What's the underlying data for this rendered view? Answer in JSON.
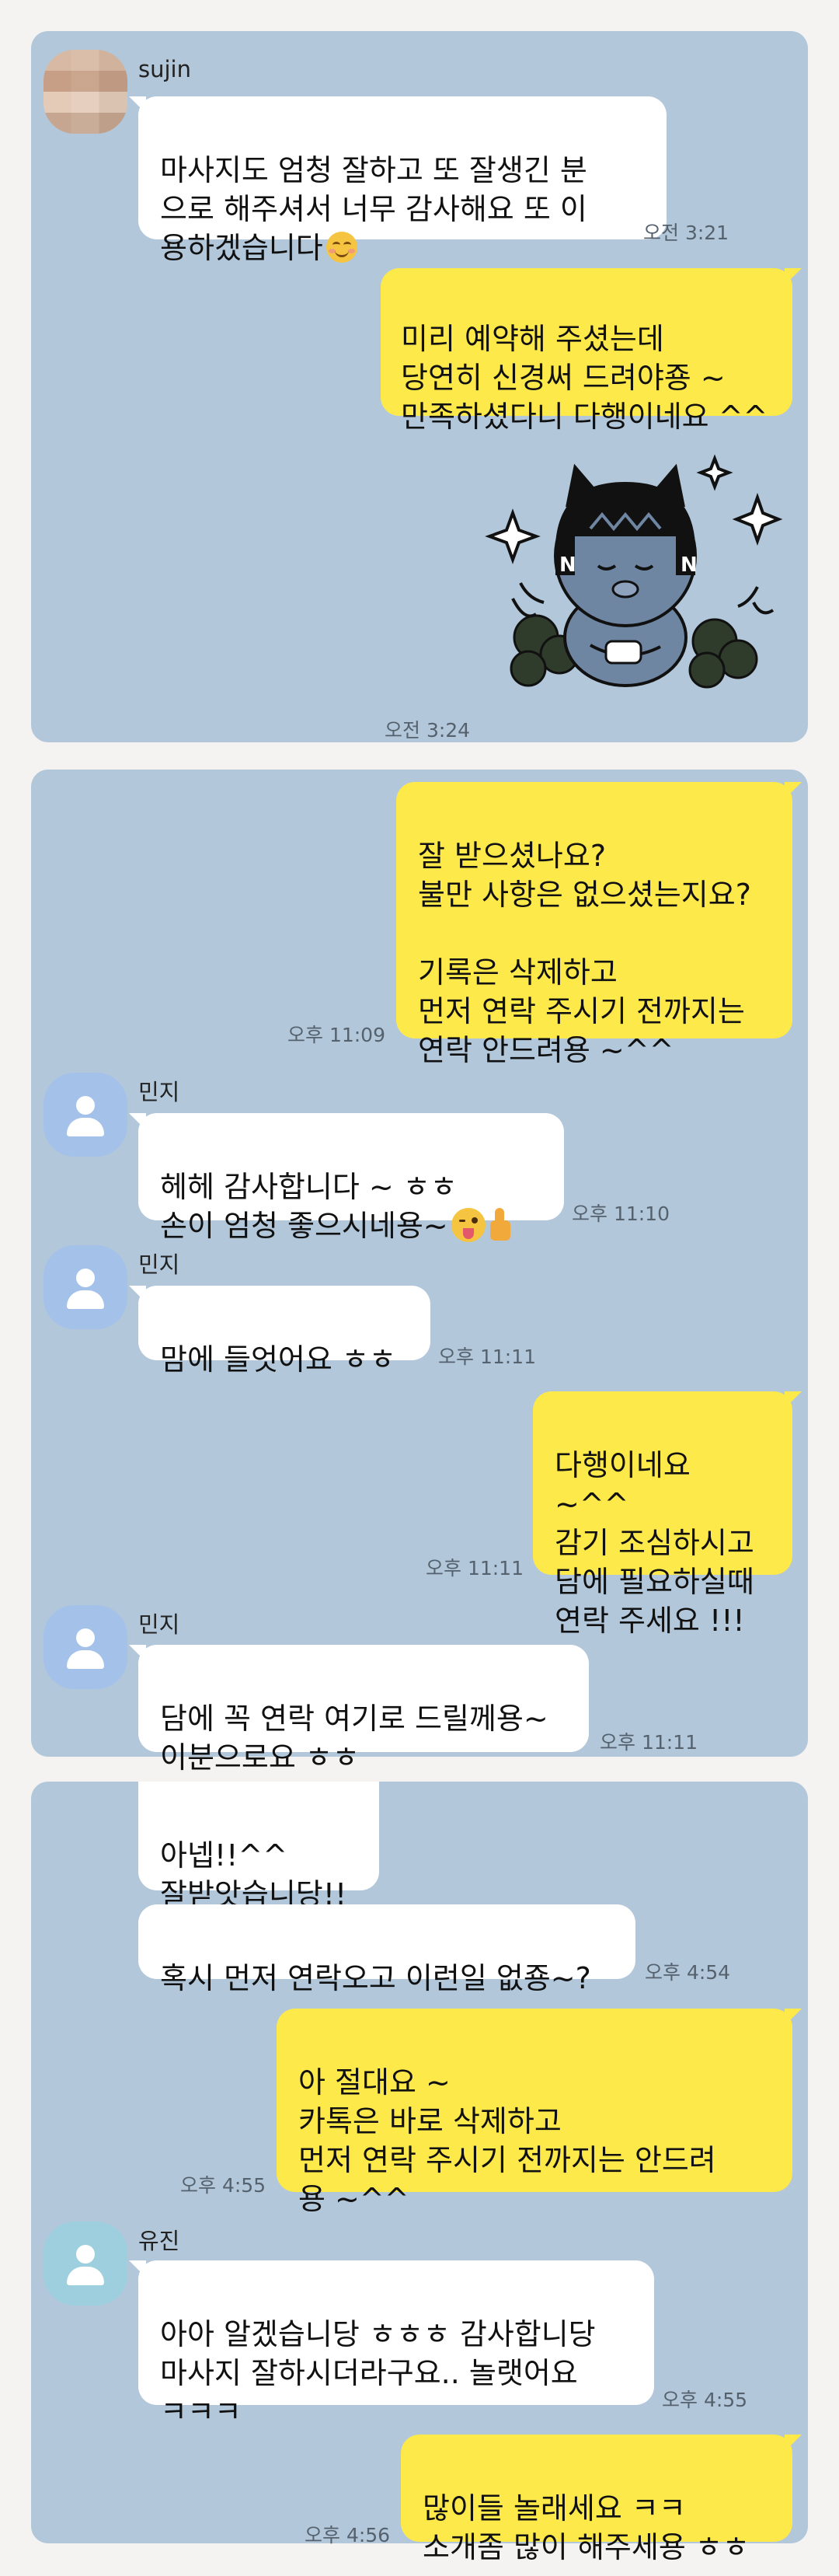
{
  "panel1": {
    "sender_name": "sujin",
    "msg1": "마사지도 엄청 잘하고 또 잘생긴 분\n으로 해주셔서 너무 감사해요 또 이\n용하겠습니다",
    "msg1_emoji": "blush-smile-emoji",
    "time1": "오전 3:21",
    "reply1": "미리 예약해 주셨는데\n당연히 신경써 드려야죵 ~\n만족하셨다니 다행이네요 ^^",
    "sticker": "kakao-friends-cat-sticker",
    "time2": "오전 3:24"
  },
  "panel2": {
    "out1": "잘 받으셨나요?\n불만 사항은 없으셨는지요?\n\n기록은 삭제하고\n먼저 연락 주시기 전까지는\n연락 안드려용 ~^^",
    "out1_time": "오후 11:09",
    "sender_name": "민지",
    "in1": "헤헤 감사합니다 ~ ㅎㅎ\n손이 엄청 좋으시네용~",
    "in1_emojis": [
      "winking-tongue-emoji",
      "thumbs-up-emoji"
    ],
    "in1_time": "오후 11:10",
    "in2": "맘에 들엇어요 ㅎㅎ",
    "in2_time": "오후 11:11",
    "out2": "다행이네요 ~^^\n감기 조심하시고\n담에 필요하실때\n연락 주세요 !!!",
    "out2_time": "오후 11:11",
    "in3": "담에 꼭 연락 여기로 드릴께용~\n이분으로요 ㅎㅎ",
    "in3_time": "오후 11:11"
  },
  "panel3": {
    "in1": "아넵!!^^\n잘받앗습니당!!",
    "in2": "혹시 먼저 연락오고 이런일 없죵~?",
    "in2_time": "오후 4:54",
    "out1": "아 절대요 ~\n카톡은 바로 삭제하고\n먼저 연락 주시기 전까지는 안드려\n용 ~^^",
    "out1_time": "오후 4:55",
    "sender_name": "유진",
    "in3": "아아 알겠습니당 ㅎㅎㅎ 감사합니당\n마사지 잘하시더라구요.. 놀랫어요\nㅋㅋㅋ",
    "in3_time": "오후 4:55",
    "out2": "많이들 놀래세요 ㅋㅋ\n소개좀 많이 해주세용 ㅎㅎ",
    "out2_time": "오후 4:56"
  },
  "colors": {
    "chat_background": "#b2c7da",
    "outgoing_bubble": "#fee94a",
    "incoming_bubble": "#ffffff",
    "avatar_default": "#a4c1ea"
  }
}
